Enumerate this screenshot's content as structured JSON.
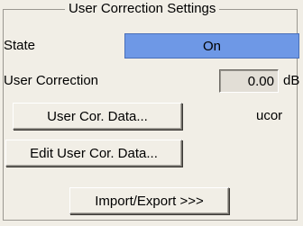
{
  "group": {
    "title": "User Correction Settings"
  },
  "state": {
    "label": "State",
    "value": "On"
  },
  "user_correction": {
    "label": "User Correction",
    "value": "0.00",
    "unit": "dB"
  },
  "buttons": {
    "user_cor_data": "User Cor. Data...",
    "edit_user_cor_data": "Edit User Cor. Data...",
    "import_export": "Import/Export >>>"
  },
  "file_name": "ucor",
  "colors": {
    "background": "#f1eee6",
    "state_on": "#6e98e6",
    "value_field": "#e2ded6"
  }
}
